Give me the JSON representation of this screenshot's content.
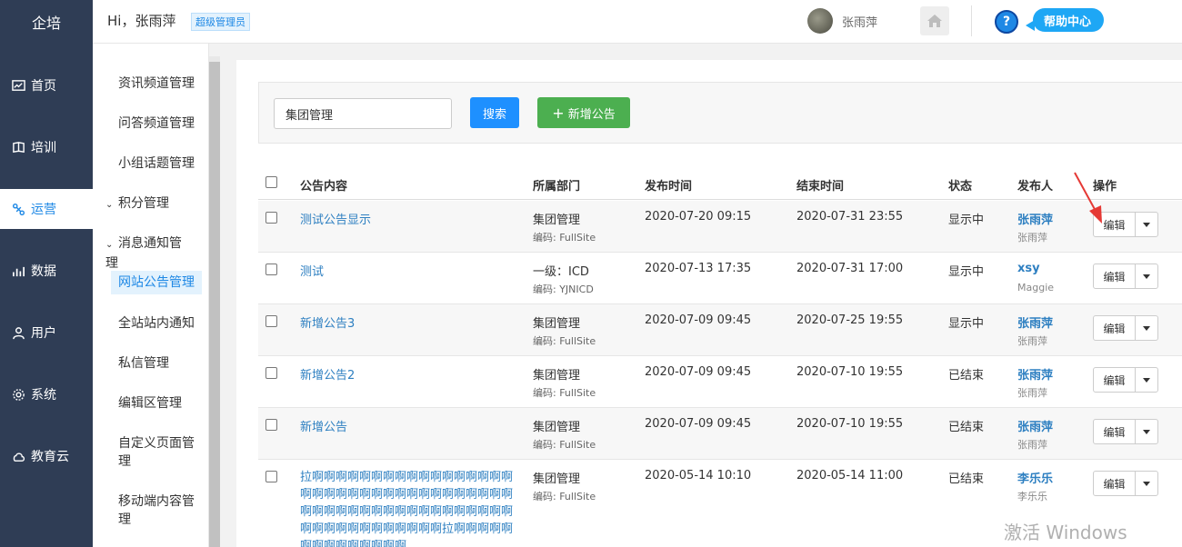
{
  "app": {
    "logo": "企培"
  },
  "nav": [
    {
      "label": "首页",
      "icon": "dashboard-icon",
      "active": false
    },
    {
      "label": "培训",
      "icon": "training-icon",
      "active": false
    },
    {
      "label": "运营",
      "icon": "operations-icon",
      "active": true
    },
    {
      "label": "数据",
      "icon": "data-chart-icon",
      "active": false
    },
    {
      "label": "用户",
      "icon": "user-icon",
      "active": false
    },
    {
      "label": "系统",
      "icon": "gear-icon",
      "active": false
    },
    {
      "label": "教育云",
      "icon": "cloud-icon",
      "active": false
    }
  ],
  "topbar": {
    "greeting": "Hi，张雨萍",
    "role": "超级管理员",
    "username": "张雨萍",
    "help_label": "帮助中心",
    "help_icon_text": "?"
  },
  "submenu": {
    "items": [
      {
        "label": "资讯频道管理"
      },
      {
        "label": "问答频道管理"
      },
      {
        "label": "小组话题管理"
      },
      {
        "label": "积分管理",
        "group": true
      },
      {
        "label": "消息通知管理",
        "group": true
      },
      {
        "label": "网站公告管理",
        "active": true
      },
      {
        "label": "全站站内通知"
      },
      {
        "label": "私信管理"
      },
      {
        "label": "编辑区管理"
      },
      {
        "label": "自定义页面管理"
      },
      {
        "label": "移动端内容管理"
      }
    ]
  },
  "search": {
    "value": "集团管理",
    "search_label": "搜索",
    "new_label": "新增公告",
    "new_icon": "+"
  },
  "table": {
    "columns": [
      "公告内容",
      "所属部门",
      "发布时间",
      "结束时间",
      "状态",
      "发布人",
      "操作"
    ],
    "edit_label": "编辑",
    "rows": [
      {
        "title": "测试公告显示",
        "dept": "集团管理",
        "code": "编码: FullSite",
        "start": "2020-07-20 09:15",
        "end": "2020-07-31 23:55",
        "status": "显示中",
        "publisher": "张雨萍",
        "publisher_sub": "张雨萍"
      },
      {
        "title": "测试",
        "dept": "一级：ICD",
        "code": "编码: YJNICD",
        "start": "2020-07-13 17:35",
        "end": "2020-07-31 17:00",
        "status": "显示中",
        "publisher": "xsy",
        "publisher_sub": "Maggie"
      },
      {
        "title": "新增公告3",
        "dept": "集团管理",
        "code": "编码: FullSite",
        "start": "2020-07-09 09:45",
        "end": "2020-07-25 19:55",
        "status": "显示中",
        "publisher": "张雨萍",
        "publisher_sub": "张雨萍"
      },
      {
        "title": "新增公告2",
        "dept": "集团管理",
        "code": "编码: FullSite",
        "start": "2020-07-09 09:45",
        "end": "2020-07-10 19:55",
        "status": "已结束",
        "publisher": "张雨萍",
        "publisher_sub": "张雨萍"
      },
      {
        "title": "新增公告",
        "dept": "集团管理",
        "code": "编码: FullSite",
        "start": "2020-07-09 09:45",
        "end": "2020-07-10 19:55",
        "status": "已结束",
        "publisher": "张雨萍",
        "publisher_sub": "张雨萍"
      },
      {
        "title": "拉啊啊啊啊啊啊啊啊啊啊啊啊啊啊啊啊啊啊啊啊啊啊啊啊啊啊啊啊啊啊啊啊啊啊啊啊啊啊啊啊啊啊啊啊啊啊啊啊啊啊啊啊啊啊啊啊啊啊啊啊啊啊啊啊啊拉啊啊啊啊啊啊啊啊啊啊啊啊啊啊",
        "dept": "集团管理",
        "code": "编码: FullSite",
        "start": "2020-05-14 10:10",
        "end": "2020-05-14 11:00",
        "status": "已结束",
        "publisher": "李乐乐",
        "publisher_sub": "李乐乐"
      }
    ]
  },
  "watermark": "激活 Windows",
  "colors": {
    "nav_bg": "#2f3d55",
    "accent": "#1e88e5",
    "search_btn": "#1e90ff",
    "new_btn": "#4caf50",
    "help_btn": "#1ea7f5",
    "arrow": "#e53935"
  }
}
